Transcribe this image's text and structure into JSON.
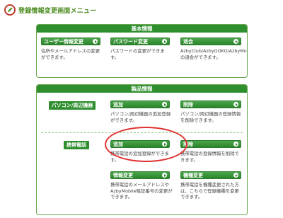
{
  "page_title": "登録情報変更画面メニュー",
  "basic_info": {
    "title": "基本情報",
    "items": [
      {
        "button": "ユーザー情報変更",
        "desc": "住所やメールアドレスの変更ができます。"
      },
      {
        "button": "パスワード変更",
        "desc": "パスワードの変更ができます。"
      },
      {
        "button": "退会",
        "desc": "AzbyClub/AzbyGOKO/AzbyMobileの退会ができます。"
      }
    ]
  },
  "product_info": {
    "title": "製品情報",
    "pc": {
      "category": "パソコン/周辺機器",
      "items": [
        {
          "button": "追加",
          "desc": "パソコン/周辺機器の追加登録ができます。"
        },
        {
          "button": "削除",
          "desc": "パソコン/周辺機器の登録情報を削除できます。"
        }
      ]
    },
    "mobile": {
      "category": "携帯電話",
      "items": [
        {
          "button": "追加",
          "desc": "携帯電話の追加登録ができます。"
        },
        {
          "button": "削除",
          "desc": "携帯電話の登録情報を削除できます。"
        },
        {
          "button": "情報変更",
          "desc": "携帯電話のメールアドレスやAzbyMobile暗証番号の変更ができます。"
        },
        {
          "button": "機種変更",
          "desc": "携帯電話を機種変更された方は、こちらで登録機種を変更できます。"
        }
      ]
    }
  },
  "colors": {
    "accent": "#2f8f2f",
    "highlight": "#e03030"
  }
}
